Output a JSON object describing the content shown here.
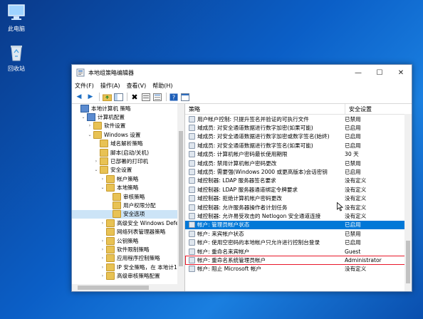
{
  "desktop": {
    "icons": [
      {
        "label": "此电脑"
      },
      {
        "label": "回收站"
      }
    ]
  },
  "window": {
    "title": "本地组策略编辑器",
    "controls": {
      "minimize": "—",
      "maximize": "☐",
      "close": "✕"
    },
    "menu": [
      "文件(F)",
      "操作(A)",
      "查看(V)",
      "帮助(H)"
    ],
    "tree": [
      {
        "label": "本地计算机 策略",
        "level": 0,
        "expander": ""
      },
      {
        "label": "计算机配置",
        "level": 1,
        "expander": "v"
      },
      {
        "label": "软件设置",
        "level": 2,
        "expander": ">"
      },
      {
        "label": "Windows 设置",
        "level": 2,
        "expander": "v"
      },
      {
        "label": "域名解析策略",
        "level": 3,
        "expander": ""
      },
      {
        "label": "脚本(启动/关机)",
        "level": 3,
        "expander": ""
      },
      {
        "label": "已部署的打印机",
        "level": 3,
        "expander": ">"
      },
      {
        "label": "安全设置",
        "level": 3,
        "expander": "v"
      },
      {
        "label": "帐户策略",
        "level": 4,
        "expander": ">"
      },
      {
        "label": "本地策略",
        "level": 4,
        "expander": "v"
      },
      {
        "label": "审核策略",
        "level": 5,
        "expander": ""
      },
      {
        "label": "用户权限分配",
        "level": 5,
        "expander": ""
      },
      {
        "label": "安全选项",
        "level": 5,
        "expander": ""
      },
      {
        "label": "高级安全 Windows Defe",
        "level": 4,
        "expander": ">"
      },
      {
        "label": "网络列表管理器策略",
        "level": 4,
        "expander": ""
      },
      {
        "label": "公钥策略",
        "level": 4,
        "expander": ">"
      },
      {
        "label": "软件限制策略",
        "level": 4,
        "expander": ">"
      },
      {
        "label": "应用程序控制策略",
        "level": 4,
        "expander": ">"
      },
      {
        "label": "IP 安全策略，在 本地计1",
        "level": 4,
        "expander": ">"
      },
      {
        "label": "高级审核策略配置",
        "level": 4,
        "expander": ">"
      }
    ],
    "columns": {
      "policy": "策略",
      "setting": "安全设置"
    },
    "policies": [
      {
        "name": "用户帐户控制: 只提升签名并验证的可执行文件",
        "value": "已禁用"
      },
      {
        "name": "域成员: 对安全通道数据进行数字加密(如果可能)",
        "value": "已启用"
      },
      {
        "name": "域成员: 对安全通道数据进行数字加密或数字签名(始终)",
        "value": "已启用"
      },
      {
        "name": "域成员: 对安全通道数据进行数字签名(如果可能)",
        "value": "已启用"
      },
      {
        "name": "域成员: 计算机帐户密码最长使用期限",
        "value": "30 天"
      },
      {
        "name": "域成员: 禁用计算机帐户密码更改",
        "value": "已禁用"
      },
      {
        "name": "域成员: 需要强(Windows 2000 或更高版本)会话密钥",
        "value": "已启用"
      },
      {
        "name": "域控制器: LDAP 服务器签名要求",
        "value": "没有定义"
      },
      {
        "name": "域控制器: LDAP 服务器通道绑定令牌要求",
        "value": "没有定义"
      },
      {
        "name": "域控制器: 拒绝计算机帐户密码更改",
        "value": "没有定义"
      },
      {
        "name": "域控制器: 允许服务器操作者计划任务",
        "value": "没有定义"
      },
      {
        "name": "域控制器: 允许易受攻击的 Netlogon 安全通道连接",
        "value": "没有定义"
      },
      {
        "name": "帐户: 管理员帐户状态",
        "value": "已启用"
      },
      {
        "name": "帐户: 来宾帐户状态",
        "value": "已禁用"
      },
      {
        "name": "帐户: 使用空密码的本地帐户只允许进行控制台登录",
        "value": "已启用"
      },
      {
        "name": "帐户: 重命名来宾帐户",
        "value": "Guest"
      },
      {
        "name": "帐户: 重命名系统管理员帐户",
        "value": "Administrator"
      },
      {
        "name": "帐户: 阻止 Microsoft 帐户",
        "value": "没有定义"
      }
    ]
  }
}
